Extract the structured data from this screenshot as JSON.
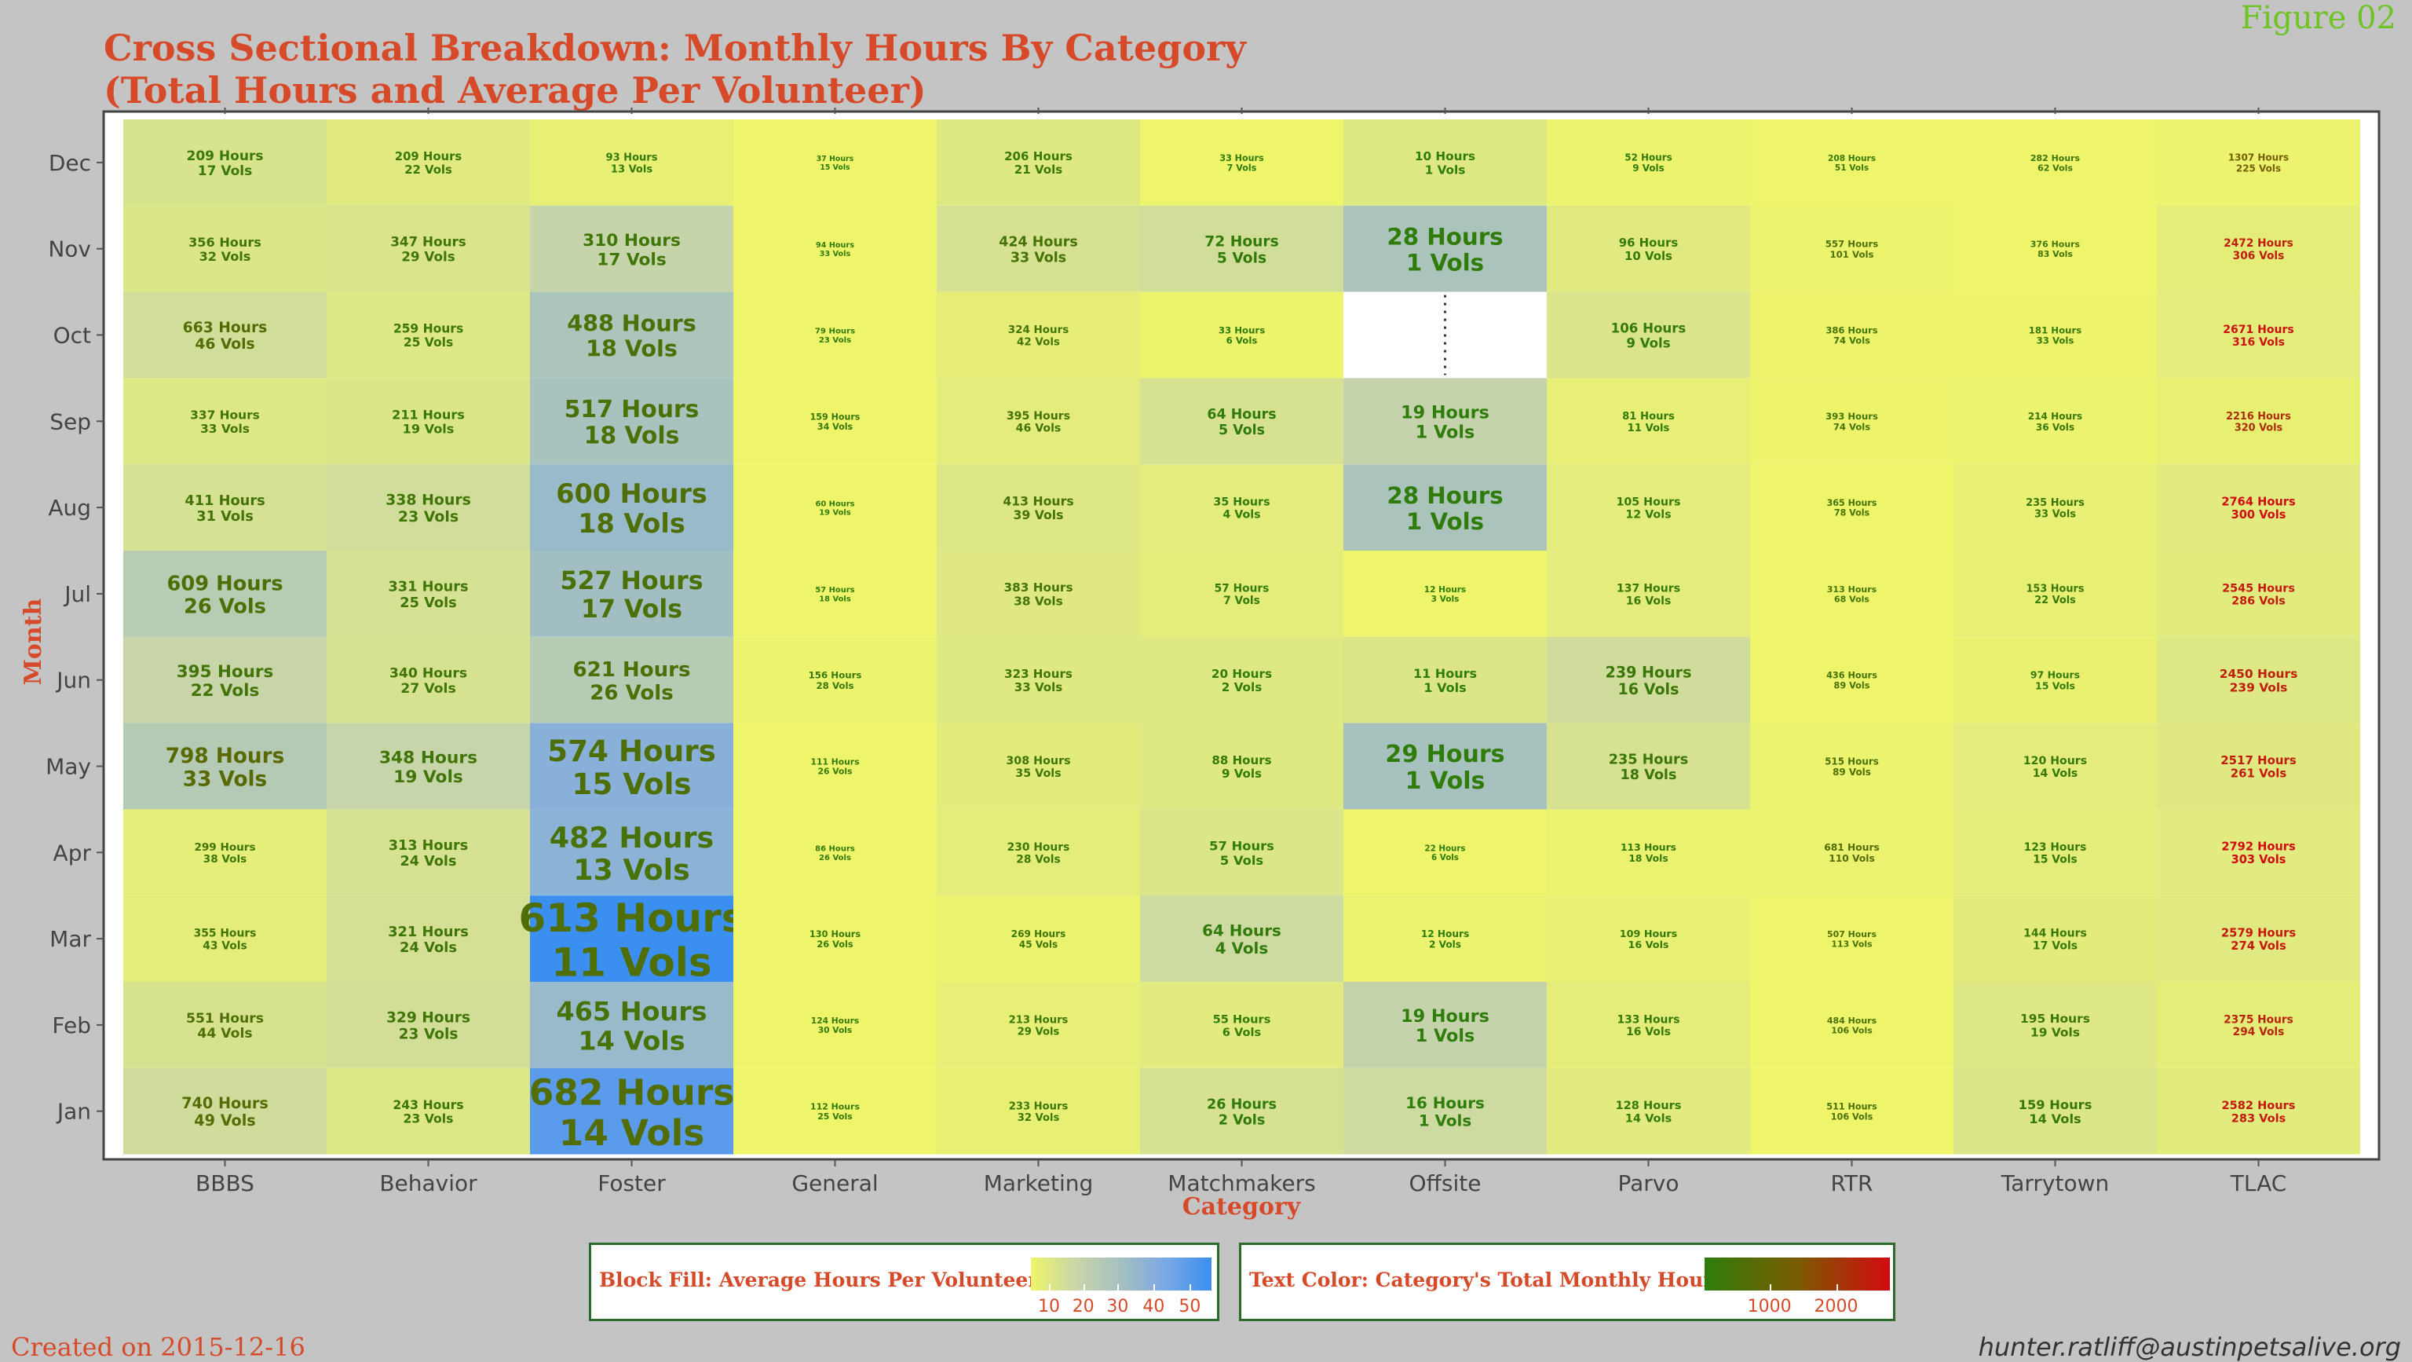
{
  "figure_label": "Figure 02",
  "title_line1": "Cross Sectional Breakdown: Monthly Hours By Category",
  "title_line2": "(Total Hours and Average Per Volunteer)",
  "created": "Created on 2015-12-16",
  "author": "hunter.ratliff@austinpetsalive.org",
  "legend_fill": {
    "label": "Block Fill:  Average Hours Per Volunteer",
    "ticks": [
      "10",
      "20",
      "30",
      "40",
      "50"
    ],
    "colors": [
      "#eef56a",
      "#c8d6a8",
      "#a4c0c0",
      "#79a8e6",
      "#3b8ff0"
    ]
  },
  "legend_text": {
    "label": "Text Color:  Category's Total Monthly Hours",
    "ticks": [
      "1000",
      "2000"
    ],
    "colors": [
      "#2e7d0a",
      "#7a5c00",
      "#d40a10"
    ]
  },
  "chart_data": {
    "type": "heatmap",
    "xlabel": "Category",
    "ylabel": "Month",
    "categories": [
      "BBBS",
      "Behavior",
      "Foster",
      "General",
      "Marketing",
      "Matchmakers",
      "Offsite",
      "Parvo",
      "RTR",
      "Tarrytown",
      "TLAC"
    ],
    "months": [
      "Dec",
      "Nov",
      "Oct",
      "Sep",
      "Aug",
      "Jul",
      "Jun",
      "May",
      "Apr",
      "Mar",
      "Feb",
      "Jan"
    ],
    "hours": [
      [
        209,
        209,
        93,
        37,
        206,
        33,
        10,
        52,
        208,
        282,
        1307
      ],
      [
        356,
        347,
        310,
        94,
        424,
        72,
        28,
        96,
        557,
        376,
        2472
      ],
      [
        663,
        259,
        488,
        79,
        324,
        33,
        null,
        106,
        386,
        181,
        2671
      ],
      [
        337,
        211,
        517,
        159,
        395,
        64,
        19,
        81,
        393,
        214,
        2216
      ],
      [
        411,
        338,
        600,
        60,
        413,
        35,
        28,
        105,
        365,
        235,
        2764
      ],
      [
        609,
        331,
        527,
        57,
        383,
        57,
        12,
        137,
        313,
        153,
        2545
      ],
      [
        395,
        340,
        621,
        156,
        323,
        20,
        11,
        239,
        436,
        97,
        2450
      ],
      [
        798,
        348,
        574,
        111,
        308,
        88,
        29,
        235,
        515,
        120,
        2517
      ],
      [
        299,
        313,
        482,
        86,
        230,
        57,
        22,
        113,
        681,
        123,
        2792
      ],
      [
        355,
        321,
        613,
        130,
        269,
        64,
        12,
        109,
        507,
        144,
        2579
      ],
      [
        551,
        329,
        465,
        124,
        213,
        55,
        19,
        133,
        484,
        195,
        2375
      ],
      [
        740,
        243,
        682,
        112,
        233,
        26,
        16,
        128,
        511,
        159,
        2582
      ]
    ],
    "vols": [
      [
        17,
        22,
        13,
        15,
        21,
        7,
        1,
        9,
        51,
        62,
        225
      ],
      [
        32,
        29,
        17,
        33,
        33,
        5,
        1,
        10,
        101,
        83,
        306
      ],
      [
        46,
        25,
        18,
        23,
        42,
        6,
        null,
        9,
        74,
        33,
        316
      ],
      [
        33,
        19,
        18,
        34,
        46,
        5,
        1,
        11,
        74,
        36,
        320
      ],
      [
        31,
        23,
        18,
        19,
        39,
        4,
        1,
        12,
        78,
        33,
        300
      ],
      [
        26,
        25,
        17,
        18,
        38,
        7,
        3,
        16,
        68,
        22,
        286
      ],
      [
        22,
        27,
        26,
        28,
        33,
        2,
        1,
        16,
        89,
        15,
        239
      ],
      [
        33,
        19,
        15,
        26,
        35,
        9,
        1,
        18,
        89,
        14,
        261
      ],
      [
        38,
        24,
        13,
        26,
        28,
        5,
        6,
        18,
        110,
        15,
        303
      ],
      [
        43,
        24,
        11,
        26,
        45,
        4,
        2,
        16,
        113,
        17,
        274
      ],
      [
        44,
        23,
        14,
        30,
        29,
        6,
        1,
        16,
        106,
        19,
        294
      ],
      [
        49,
        23,
        14,
        25,
        32,
        2,
        1,
        14,
        106,
        14,
        283
      ]
    ],
    "fill_scale_label": "Average Hours Per Volunteer",
    "text_scale_label": "Category's Total Monthly Hours"
  }
}
